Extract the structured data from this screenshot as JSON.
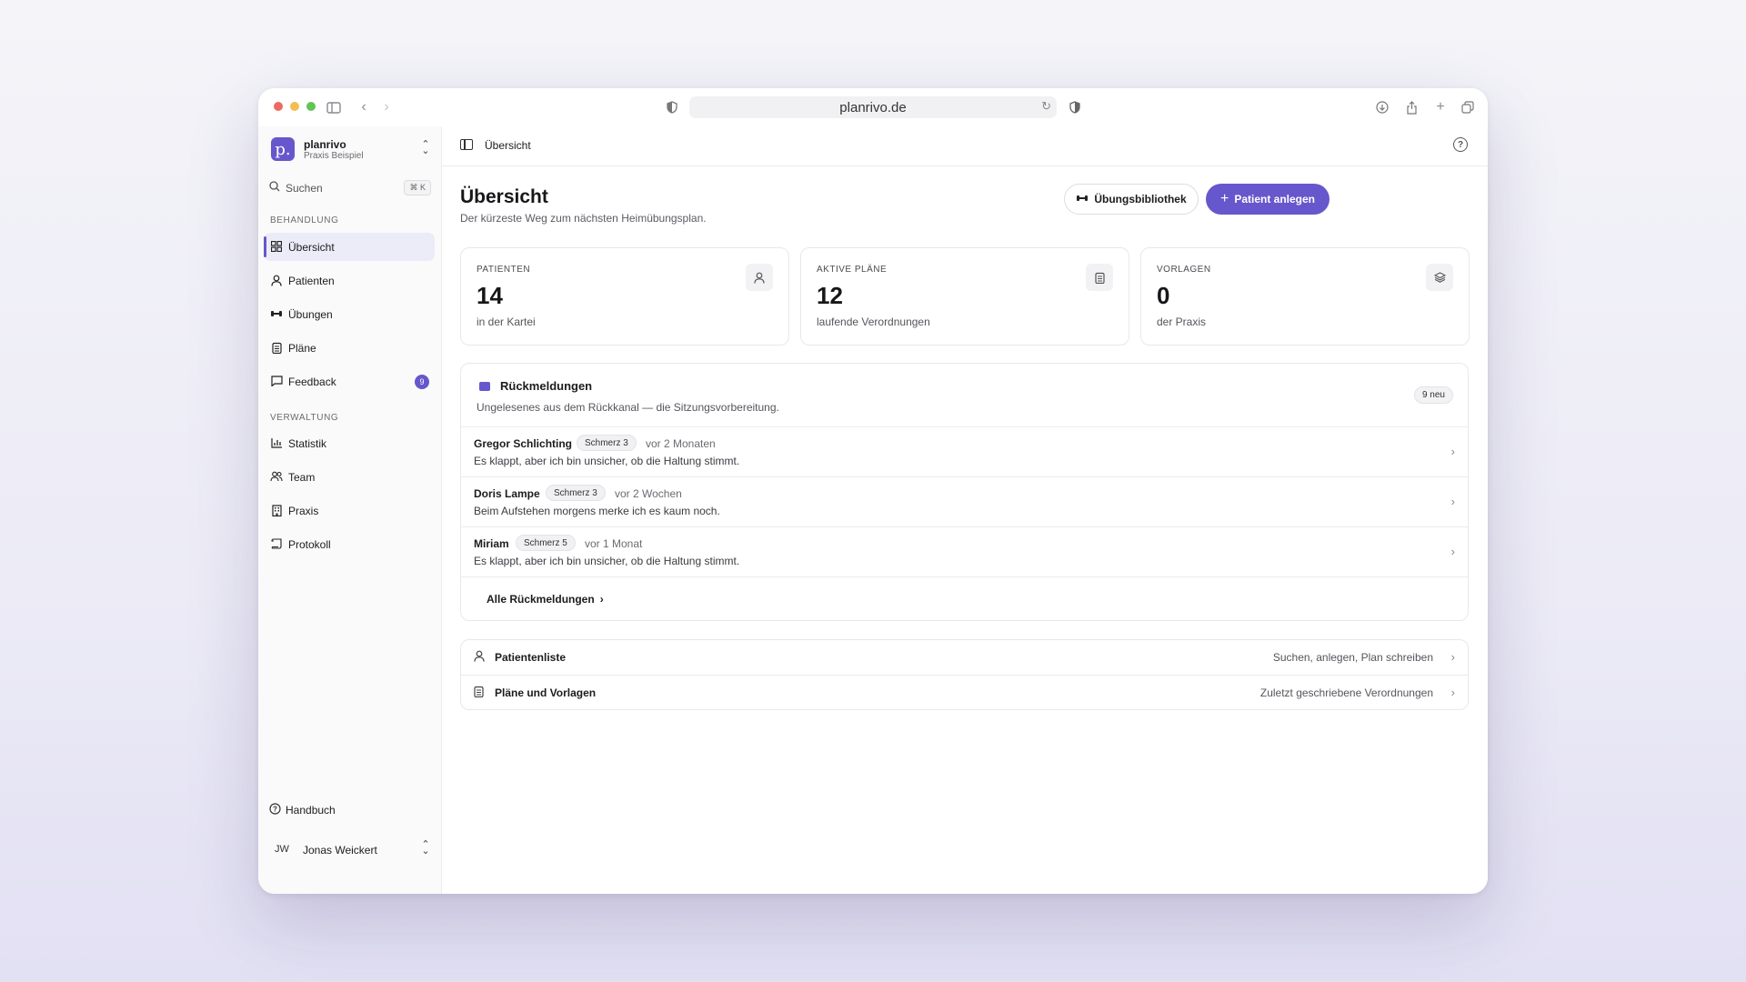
{
  "browser": {
    "url": "planrivo.de",
    "traffic_colors": [
      "#ee6a5f",
      "#f5bd4f",
      "#61c454"
    ]
  },
  "brand": {
    "logo_letter": "p.",
    "name": "planrivo",
    "subtitle": "Praxis Beispiel"
  },
  "search": {
    "label": "Suchen",
    "shortcut": "⌘ K"
  },
  "sidebar": {
    "section_treatment": "BEHANDLUNG",
    "section_admin": "VERWALTUNG",
    "items": [
      {
        "label": "Übersicht"
      },
      {
        "label": "Patienten"
      },
      {
        "label": "Übungen"
      },
      {
        "label": "Pläne"
      },
      {
        "label": "Feedback",
        "badge": "9"
      },
      {
        "label": "Statistik"
      },
      {
        "label": "Team"
      },
      {
        "label": "Praxis"
      },
      {
        "label": "Protokoll"
      }
    ],
    "help_label": "Handbuch",
    "user_initials": "JW",
    "user_name": "Jonas Weickert"
  },
  "topbar": {
    "breadcrumb": "Übersicht"
  },
  "page": {
    "title": "Übersicht",
    "subtitle": "Der kürzeste Weg zum nächsten Heimübungsplan.",
    "btn_library": "Übungsbibliothek",
    "btn_new_patient": "Patient anlegen"
  },
  "stats": [
    {
      "label": "PATIENTEN",
      "value": "14",
      "sub": "in der Kartei",
      "icon": "user-icon"
    },
    {
      "label": "AKTIVE PLÄNE",
      "value": "12",
      "sub": "laufende Verordnungen",
      "icon": "clipboard-icon"
    },
    {
      "label": "VORLAGEN",
      "value": "0",
      "sub": "der Praxis",
      "icon": "layers-icon"
    }
  ],
  "feedback": {
    "title": "Rückmeldungen",
    "subtitle": "Ungelesenes aus dem Rückkanal — die Sitzungsvorbereitung.",
    "new_badge": "9 neu",
    "rows": [
      {
        "name": "Gregor Schlichting",
        "pain": "Schmerz 3",
        "time": "vor 2 Monaten",
        "message": "Es klappt, aber ich bin unsicher, ob die Haltung stimmt."
      },
      {
        "name": "Doris Lampe",
        "pain": "Schmerz 3",
        "time": "vor 2 Wochen",
        "message": "Beim Aufstehen morgens merke ich es kaum noch."
      },
      {
        "name": "Miriam",
        "pain": "Schmerz 5",
        "time": "vor 1 Monat",
        "message": "Es klappt, aber ich bin unsicher, ob die Haltung stimmt."
      }
    ],
    "all_link": "Alle Rückmeldungen"
  },
  "quicklinks": [
    {
      "label": "Patientenliste",
      "hint": "Suchen, anlegen, Plan schreiben"
    },
    {
      "label": "Pläne und Vorlagen",
      "hint": "Zuletzt geschriebene Verordnungen"
    }
  ],
  "colors": {
    "accent": "#6657cc"
  }
}
